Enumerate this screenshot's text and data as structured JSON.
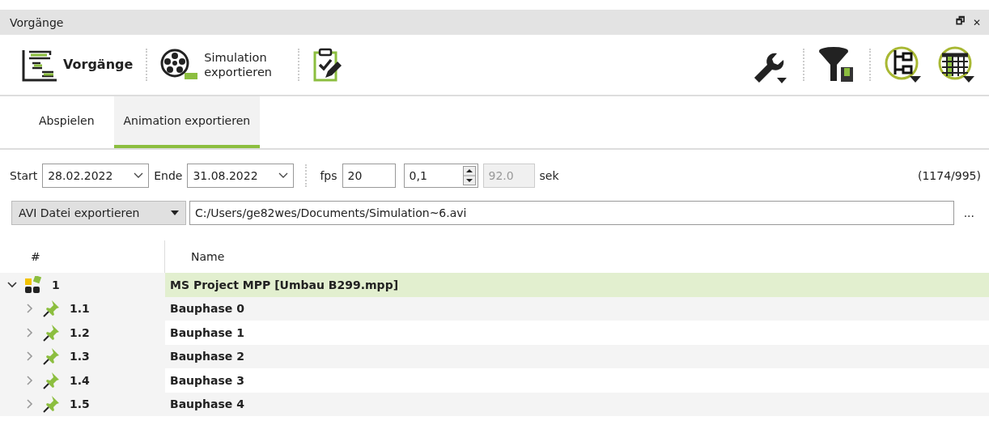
{
  "window": {
    "title": "Vorgänge",
    "controls": [
      "🗗",
      "✕"
    ]
  },
  "toolbar": {
    "left": [
      {
        "kind": "gantt",
        "label": "Vorgänge",
        "bold": true
      },
      {
        "kind": "film",
        "label": "Simulation exportieren",
        "bold": false
      },
      {
        "kind": "clipboard"
      }
    ],
    "right": [
      {
        "kind": "wrench"
      },
      {
        "kind": "filter"
      },
      {
        "kind": "tree"
      },
      {
        "kind": "grid"
      }
    ]
  },
  "tabs": [
    {
      "label": "Abspielen",
      "selected": false
    },
    {
      "label": "Animation exportieren",
      "selected": true
    }
  ],
  "range": {
    "start_label": "Start",
    "start": "28.02.2022",
    "end_label": "Ende",
    "end": "31.08.2022",
    "fps_label": "fps",
    "fps": "20",
    "step": "0,1",
    "duration": "92.0",
    "unit": "sek",
    "count": "(1174/995)"
  },
  "export": {
    "format": "AVI Datei exportieren",
    "path": "C:/Users/ge82wes/Documents/Simulation~6.avi",
    "browse": "..."
  },
  "tree": {
    "columns": [
      "#",
      "Name"
    ],
    "rows": [
      {
        "id": "1",
        "name": "MS Project MPP [Umbau B299.mpp]",
        "kind": "project",
        "expanded": true,
        "selected": true,
        "children": [
          {
            "id": "1.1",
            "name": "Bauphase 0",
            "kind": "phase",
            "expanded": false,
            "selected": false
          },
          {
            "id": "1.2",
            "name": "Bauphase 1",
            "kind": "phase",
            "expanded": false,
            "selected": false
          },
          {
            "id": "1.3",
            "name": "Bauphase 2",
            "kind": "phase",
            "expanded": false,
            "selected": false
          },
          {
            "id": "1.4",
            "name": "Bauphase 3",
            "kind": "phase",
            "expanded": false,
            "selected": false
          },
          {
            "id": "1.5",
            "name": "Bauphase 4",
            "kind": "phase",
            "expanded": false,
            "selected": false
          }
        ]
      }
    ]
  }
}
